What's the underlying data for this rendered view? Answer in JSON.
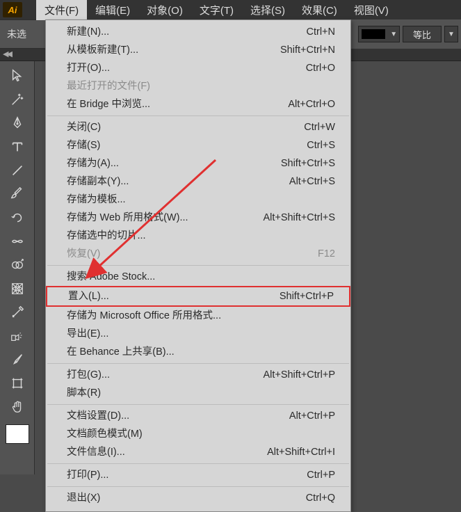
{
  "app_icon": "Ai",
  "menubar": {
    "file": "文件(F)",
    "edit": "编辑(E)",
    "object": "对象(O)",
    "type": "文字(T)",
    "select": "选择(S)",
    "effect": "效果(C)",
    "view": "视图(V)"
  },
  "toolbar": {
    "no_selection": "未选"
  },
  "right_combo_label": "等比",
  "menu": {
    "new": "新建(N)...",
    "new_s": "Ctrl+N",
    "new_tpl": "从模板新建(T)...",
    "new_tpl_s": "Shift+Ctrl+N",
    "open": "打开(O)...",
    "open_s": "Ctrl+O",
    "recent": "最近打开的文件(F)",
    "bridge": "在 Bridge 中浏览...",
    "bridge_s": "Alt+Ctrl+O",
    "close": "关闭(C)",
    "close_s": "Ctrl+W",
    "save": "存储(S)",
    "save_s": "Ctrl+S",
    "saveas": "存储为(A)...",
    "saveas_s": "Shift+Ctrl+S",
    "savecopy": "存储副本(Y)...",
    "savecopy_s": "Alt+Ctrl+S",
    "savetpl": "存储为模板...",
    "saveweb": "存储为 Web 所用格式(W)...",
    "saveweb_s": "Alt+Shift+Ctrl+S",
    "saveslice": "存储选中的切片...",
    "revert": "恢复(V)",
    "revert_s": "F12",
    "stock": "搜索 Adobe Stock...",
    "place": "置入(L)...",
    "place_s": "Shift+Ctrl+P",
    "msoffice": "存储为 Microsoft Office 所用格式...",
    "export": "导出(E)...",
    "behance": "在 Behance 上共享(B)...",
    "package": "打包(G)...",
    "package_s": "Alt+Shift+Ctrl+P",
    "scripts": "脚本(R)",
    "docsetup": "文档设置(D)...",
    "docsetup_s": "Alt+Ctrl+P",
    "colormode": "文档颜色模式(M)",
    "fileinfo": "文件信息(I)...",
    "fileinfo_s": "Alt+Shift+Ctrl+I",
    "print": "打印(P)...",
    "print_s": "Ctrl+P",
    "exit": "退出(X)",
    "exit_s": "Ctrl+Q"
  }
}
